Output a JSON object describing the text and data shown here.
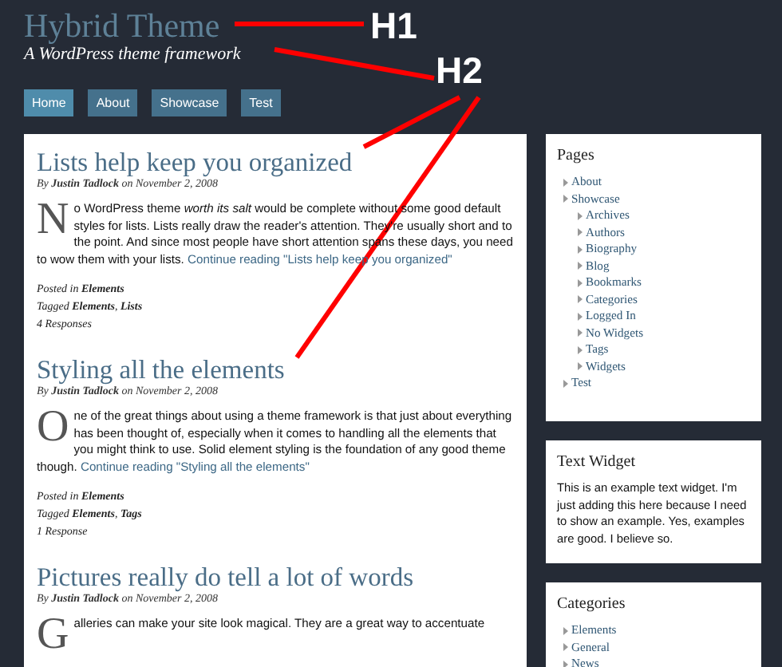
{
  "site": {
    "title": "Hybrid Theme",
    "tagline": "A WordPress theme framework"
  },
  "nav": [
    {
      "label": "Home",
      "selected": true
    },
    {
      "label": "About",
      "selected": false
    },
    {
      "label": "Showcase",
      "selected": false
    },
    {
      "label": "Test",
      "selected": false
    }
  ],
  "posts": [
    {
      "title": "Lists help keep you organized",
      "byline": "By **Justin Tadlock** on November 2, 2008",
      "drop_cap": "N",
      "text": "o WordPress theme *worth its salt* would be complete without some good default styles for lists. Lists really draw the reader's attention. They're usually short and to the point. And since most people have short attention spans these days, you need to wow them with your lists.",
      "more": "Continue reading \"Lists help keep you organized\"",
      "posted_in": "Posted in **Elements**",
      "tagged": "Tagged **Elements**, **Lists**",
      "responses": "4 Responses"
    },
    {
      "title": "Styling all the elements",
      "byline": "By **Justin Tadlock** on November 2, 2008",
      "drop_cap": "O",
      "text": "ne of the great things about using a theme framework is that just about everything has been thought of, especially when it comes to handling all the elements that you might think to use. Solid element styling is the foundation of any good theme though.",
      "more": "Continue reading \"Styling all the elements\"",
      "posted_in": "Posted in **Elements**",
      "tagged": "Tagged **Elements**, **Tags**",
      "responses": "1 Response"
    },
    {
      "title": "Pictures really do tell a lot of words",
      "byline": "By **Justin Tadlock** on November 2, 2008",
      "drop_cap": "G",
      "text": "alleries can make your site look magical. They are a great way to accentuate"
    }
  ],
  "sidebar": {
    "pages": {
      "title": "Pages",
      "items": [
        {
          "label": "About"
        },
        {
          "label": "Showcase",
          "children": [
            {
              "label": "Archives"
            },
            {
              "label": "Authors"
            },
            {
              "label": "Biography"
            },
            {
              "label": "Blog"
            },
            {
              "label": "Bookmarks"
            },
            {
              "label": "Categories"
            },
            {
              "label": "Logged In"
            },
            {
              "label": "No Widgets"
            },
            {
              "label": "Tags"
            },
            {
              "label": "Widgets"
            }
          ]
        },
        {
          "label": "Test"
        }
      ]
    },
    "text_widget": {
      "title": "Text Widget",
      "text": "This is an example text widget. I'm just adding this here because I need to show an example. Yes, examples are good. I believe so."
    },
    "categories": {
      "title": "Categories",
      "items": [
        {
          "label": "Elements"
        },
        {
          "label": "General"
        },
        {
          "label": "News"
        }
      ]
    }
  },
  "annotations": [
    {
      "label": "H1"
    },
    {
      "label": "H2"
    }
  ]
}
